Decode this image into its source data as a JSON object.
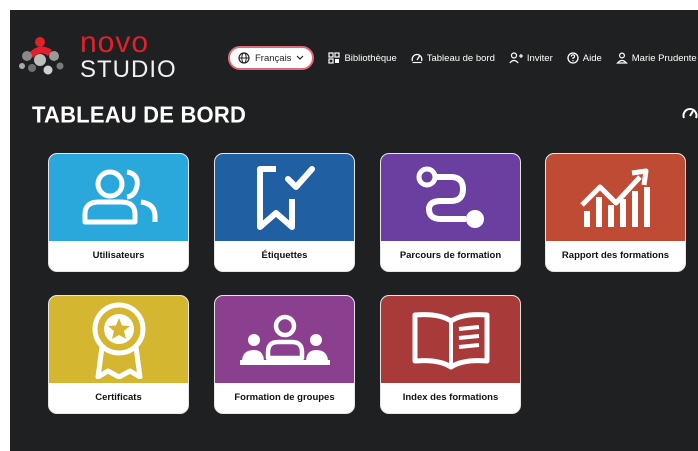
{
  "brand": {
    "line1": "novo",
    "line2": "STUDIO"
  },
  "header": {
    "language": "Français",
    "nav": [
      "Bibliothèque",
      "Tableau de bord",
      "Inviter",
      "Aide"
    ],
    "user": "Marie Prudente"
  },
  "page": {
    "title": "TABLEAU DE BORD"
  },
  "tiles": [
    {
      "label": "Utilisateurs",
      "color": "#2aa8dc",
      "icon": "users-icon"
    },
    {
      "label": "Étiquettes",
      "color": "#1f5fa2",
      "icon": "bookmark-check-icon"
    },
    {
      "label": "Parcours de formation",
      "color": "#6a3fa0",
      "icon": "route-icon"
    },
    {
      "label": "Rapport des formations",
      "color": "#bf4b35",
      "icon": "chart-icon"
    },
    {
      "label": "Certificats",
      "color": "#d4b631",
      "icon": "award-icon"
    },
    {
      "label": "Formation de groupes",
      "color": "#8a3f8f",
      "icon": "group-icon"
    },
    {
      "label": "Index des formations",
      "color": "#a83a3a",
      "icon": "book-icon"
    }
  ]
}
